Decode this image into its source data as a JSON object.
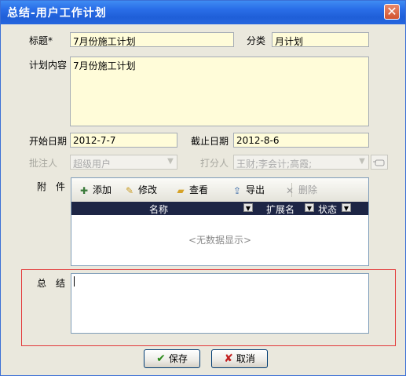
{
  "window": {
    "title": "总结-用户工作计划",
    "close_glyph": "✕"
  },
  "form": {
    "title_label": "标题*",
    "title_value": "7月份施工计划",
    "category_label": "分类",
    "category_value": "月计划",
    "content_label": "计划内容",
    "content_value": "7月份施工计划",
    "start_label": "开始日期",
    "start_value": "2012-7-7",
    "end_label": "截止日期",
    "end_value": "2012-8-6",
    "approver_label": "批注人",
    "approver_value": "超级用户",
    "scorer_label": "打分人",
    "scorer_value": "王财;李会计;高霞;",
    "attach_label": "附　件",
    "summary_label": "总　结",
    "summary_value": ""
  },
  "attachments": {
    "toolbar": {
      "add": "添加",
      "edit": "修改",
      "view": "查看",
      "export": "导出",
      "delete": "删除"
    },
    "columns": [
      "名称",
      "扩展名",
      "状态"
    ],
    "empty_text": "<无数据显示>"
  },
  "buttons": {
    "save": "保存",
    "cancel": "取消"
  },
  "colors": {
    "titlebar": "#2a6ee8",
    "field_bg": "#fffcd9",
    "dialog_bg": "#eae8dd",
    "highlight_border": "#e33838"
  }
}
